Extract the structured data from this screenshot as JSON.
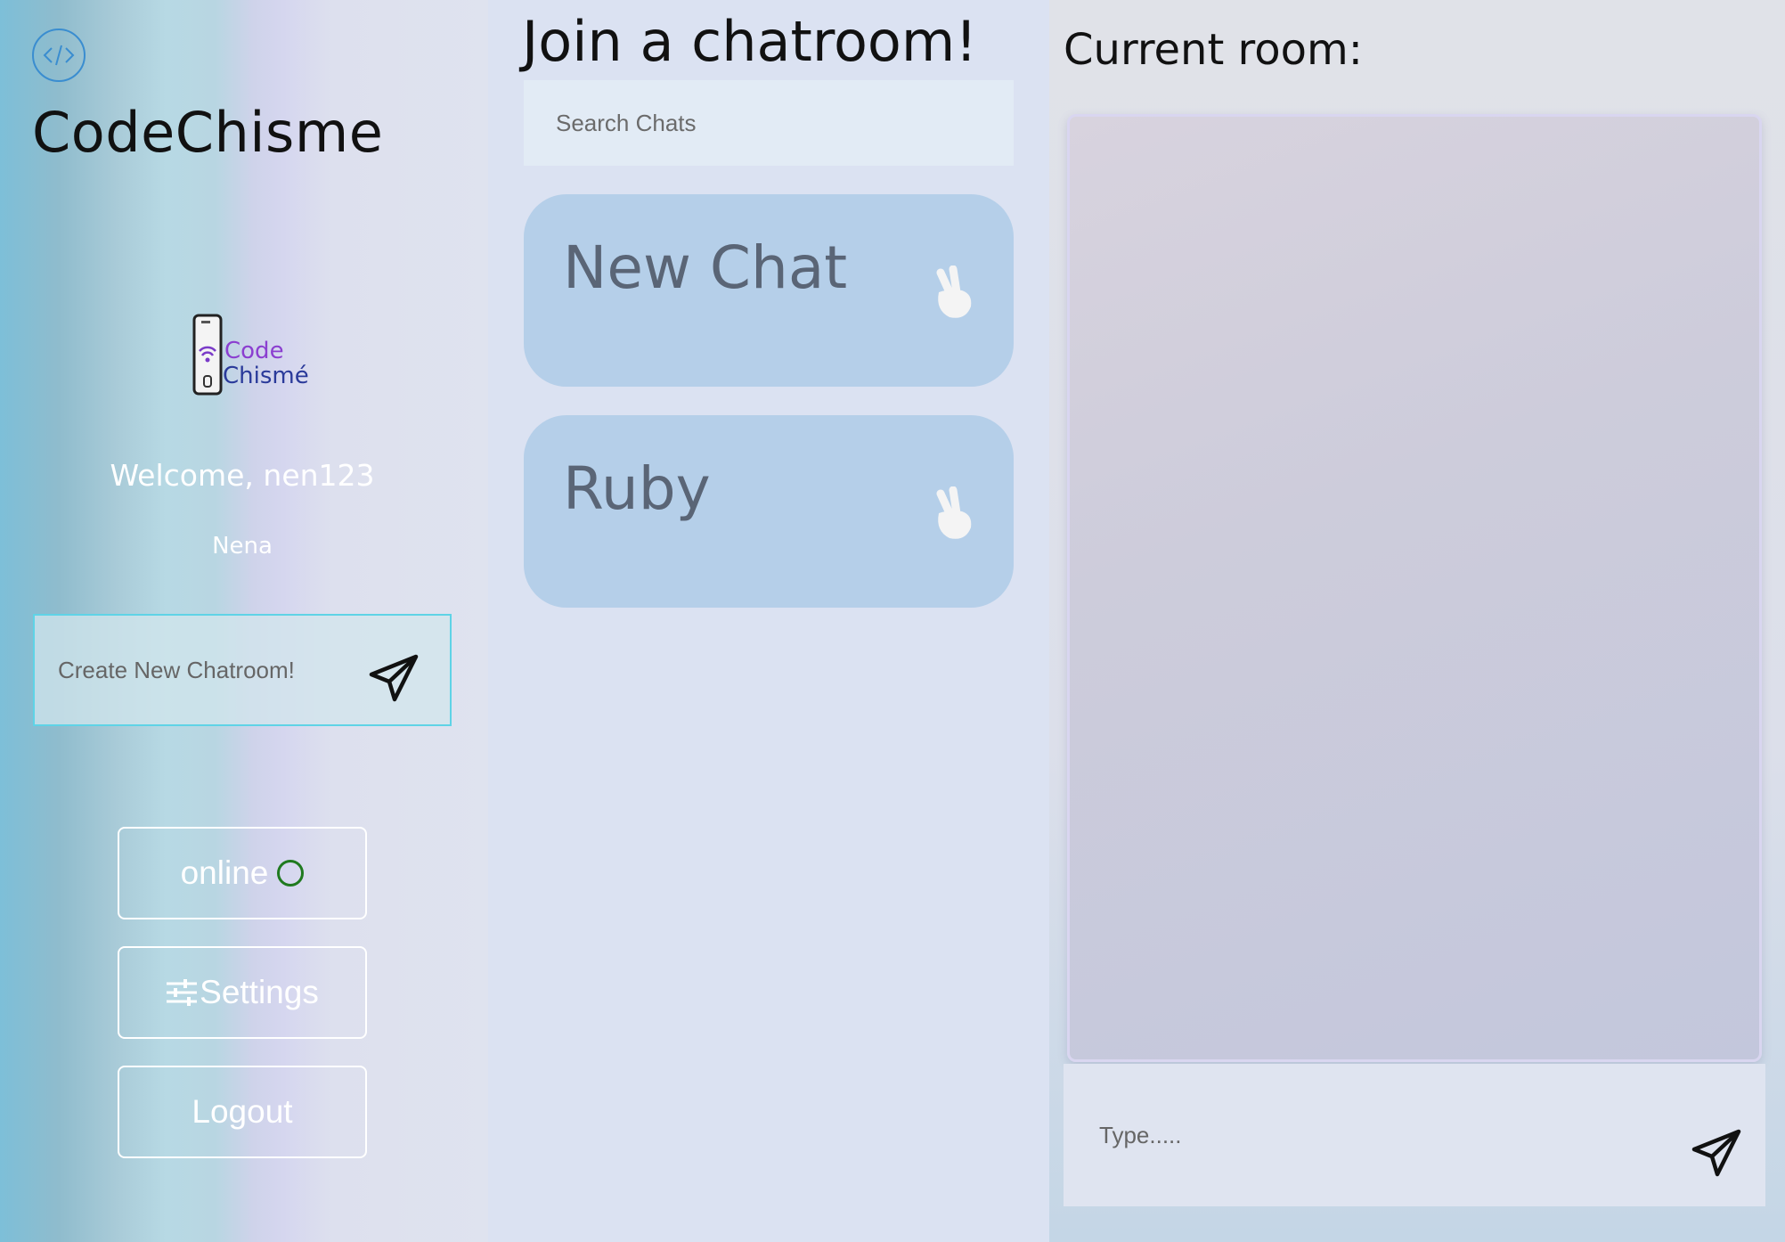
{
  "sidebar": {
    "logo_icon": "code-brackets-icon",
    "brand": "CodeChisme",
    "avatar": {
      "brand_line1": "Code",
      "brand_line2": "Chismé"
    },
    "welcome": "Welcome, nen123",
    "username": "Nena",
    "create_placeholder": "Create New Chatroom!",
    "create_send_icon": "paper-plane-icon",
    "buttons": {
      "online": "online",
      "settings": "Settings",
      "logout": "Logout"
    },
    "status_color": "#1f7a1f"
  },
  "middle": {
    "title": "Join a chatroom!",
    "search_placeholder": "Search Chats",
    "rooms": [
      {
        "name": "New Chat",
        "icon": "peace-hand-icon"
      },
      {
        "name": "Ruby",
        "icon": "peace-hand-icon"
      }
    ]
  },
  "right": {
    "title": "Current room:",
    "message_placeholder": "Type.....",
    "send_icon": "paper-plane-icon"
  },
  "colors": {
    "accent_border": "#5fd3e6",
    "card_bg": "#b5cfe9",
    "card_text": "#5a6576"
  }
}
